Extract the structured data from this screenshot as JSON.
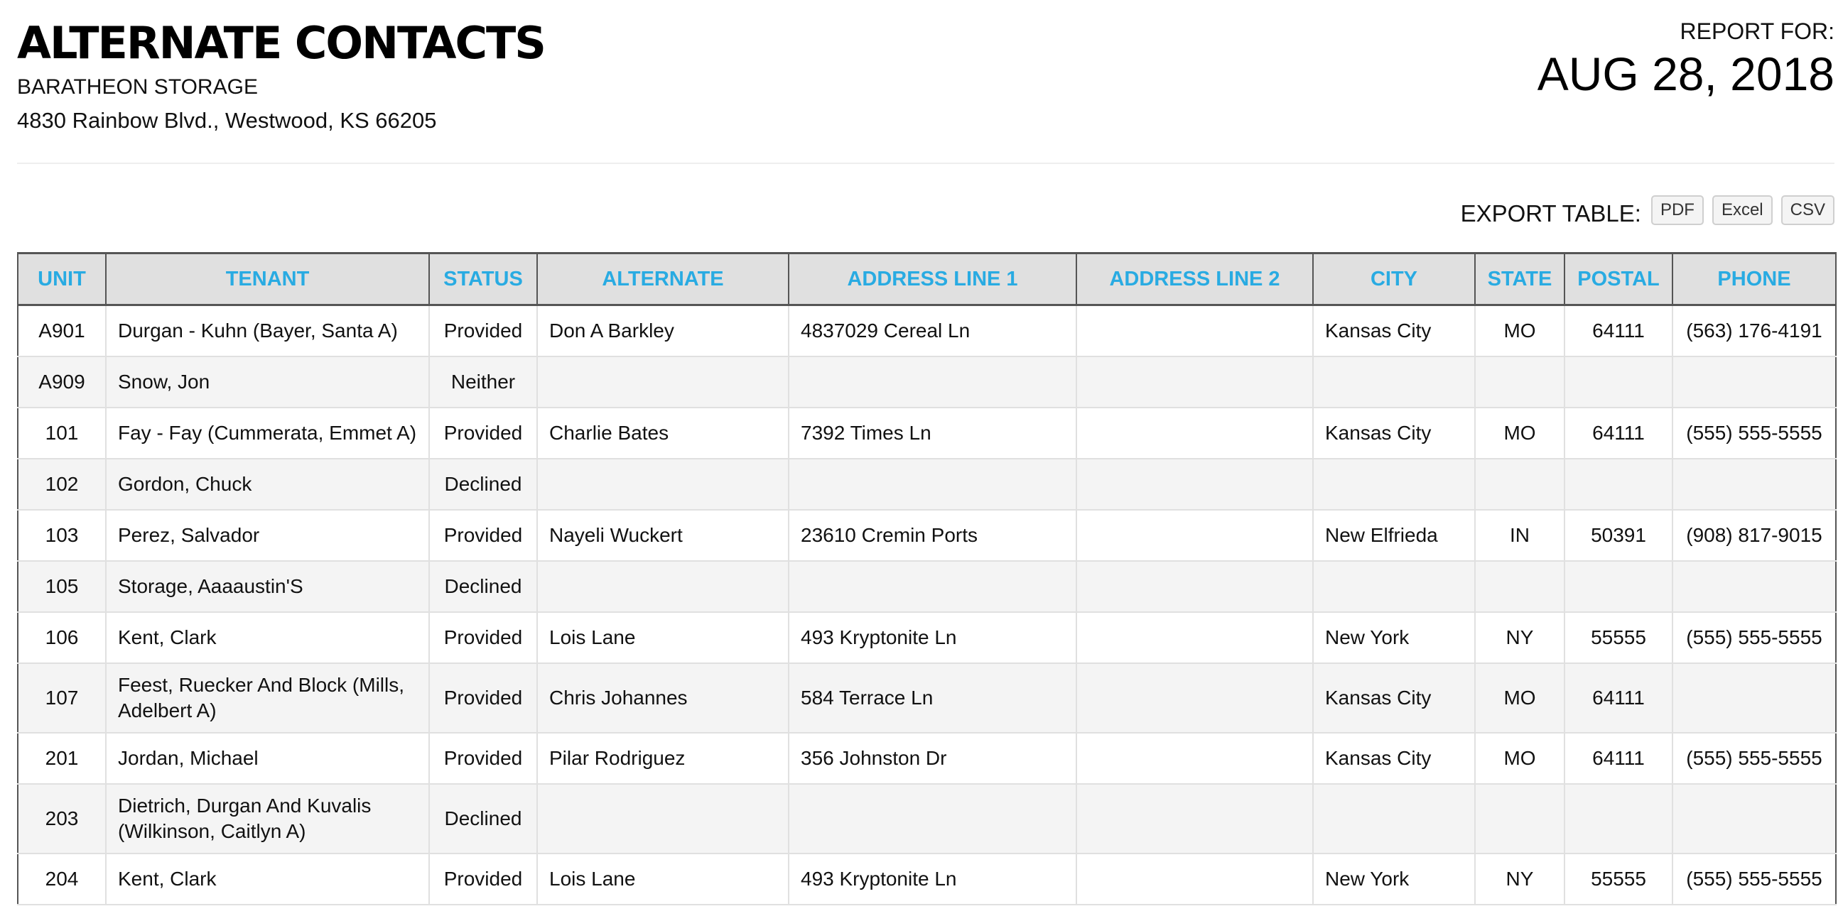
{
  "header": {
    "title": "ALTERNATE CONTACTS",
    "company": "BARATHEON STORAGE",
    "address": "4830 Rainbow Blvd., Westwood, KS 66205",
    "report_for_label": "REPORT FOR:",
    "report_date": "AUG 28, 2018"
  },
  "export": {
    "label": "EXPORT TABLE:",
    "buttons": [
      "PDF",
      "Excel",
      "CSV"
    ]
  },
  "colors": {
    "header_text": "#29abe2",
    "header_bg": "#e0e0e0",
    "row_alt_bg": "#f4f4f4"
  },
  "table": {
    "columns": [
      "UNIT",
      "TENANT",
      "STATUS",
      "ALTERNATE",
      "ADDRESS LINE 1",
      "ADDRESS LINE 2",
      "CITY",
      "STATE",
      "POSTAL",
      "PHONE"
    ],
    "rows": [
      [
        "A901",
        "Durgan - Kuhn (Bayer, Santa A)",
        "Provided",
        "Don A Barkley",
        "4837029 Cereal Ln",
        "",
        "Kansas City",
        "MO",
        "64111",
        "(563) 176-4191"
      ],
      [
        "A909",
        "Snow, Jon",
        "Neither",
        "",
        "",
        "",
        "",
        "",
        "",
        ""
      ],
      [
        "101",
        "Fay - Fay (Cummerata, Emmet A)",
        "Provided",
        "Charlie Bates",
        "7392 Times Ln",
        "",
        "Kansas City",
        "MO",
        "64111",
        "(555) 555-5555"
      ],
      [
        "102",
        "Gordon, Chuck",
        "Declined",
        "",
        "",
        "",
        "",
        "",
        "",
        ""
      ],
      [
        "103",
        "Perez, Salvador",
        "Provided",
        "Nayeli Wuckert",
        "23610 Cremin Ports",
        "",
        "New Elfrieda",
        "IN",
        "50391",
        "(908) 817-9015"
      ],
      [
        "105",
        "Storage, Aaaaustin'S",
        "Declined",
        "",
        "",
        "",
        "",
        "",
        "",
        ""
      ],
      [
        "106",
        "Kent, Clark",
        "Provided",
        "Lois Lane",
        "493 Kryptonite Ln",
        "",
        "New York",
        "NY",
        "55555",
        "(555) 555-5555"
      ],
      [
        "107",
        "Feest, Ruecker And Block (Mills, Adelbert A)",
        "Provided",
        "Chris Johannes",
        "584 Terrace Ln",
        "",
        "Kansas City",
        "MO",
        "64111",
        ""
      ],
      [
        "201",
        "Jordan, Michael",
        "Provided",
        "Pilar Rodriguez",
        "356 Johnston Dr",
        "",
        "Kansas City",
        "MO",
        "64111",
        "(555) 555-5555"
      ],
      [
        "203",
        "Dietrich, Durgan And Kuvalis (Wilkinson, Caitlyn A)",
        "Declined",
        "",
        "",
        "",
        "",
        "",
        "",
        ""
      ],
      [
        "204",
        "Kent, Clark",
        "Provided",
        "Lois Lane",
        "493 Kryptonite Ln",
        "",
        "New York",
        "NY",
        "55555",
        "(555) 555-5555"
      ]
    ]
  }
}
